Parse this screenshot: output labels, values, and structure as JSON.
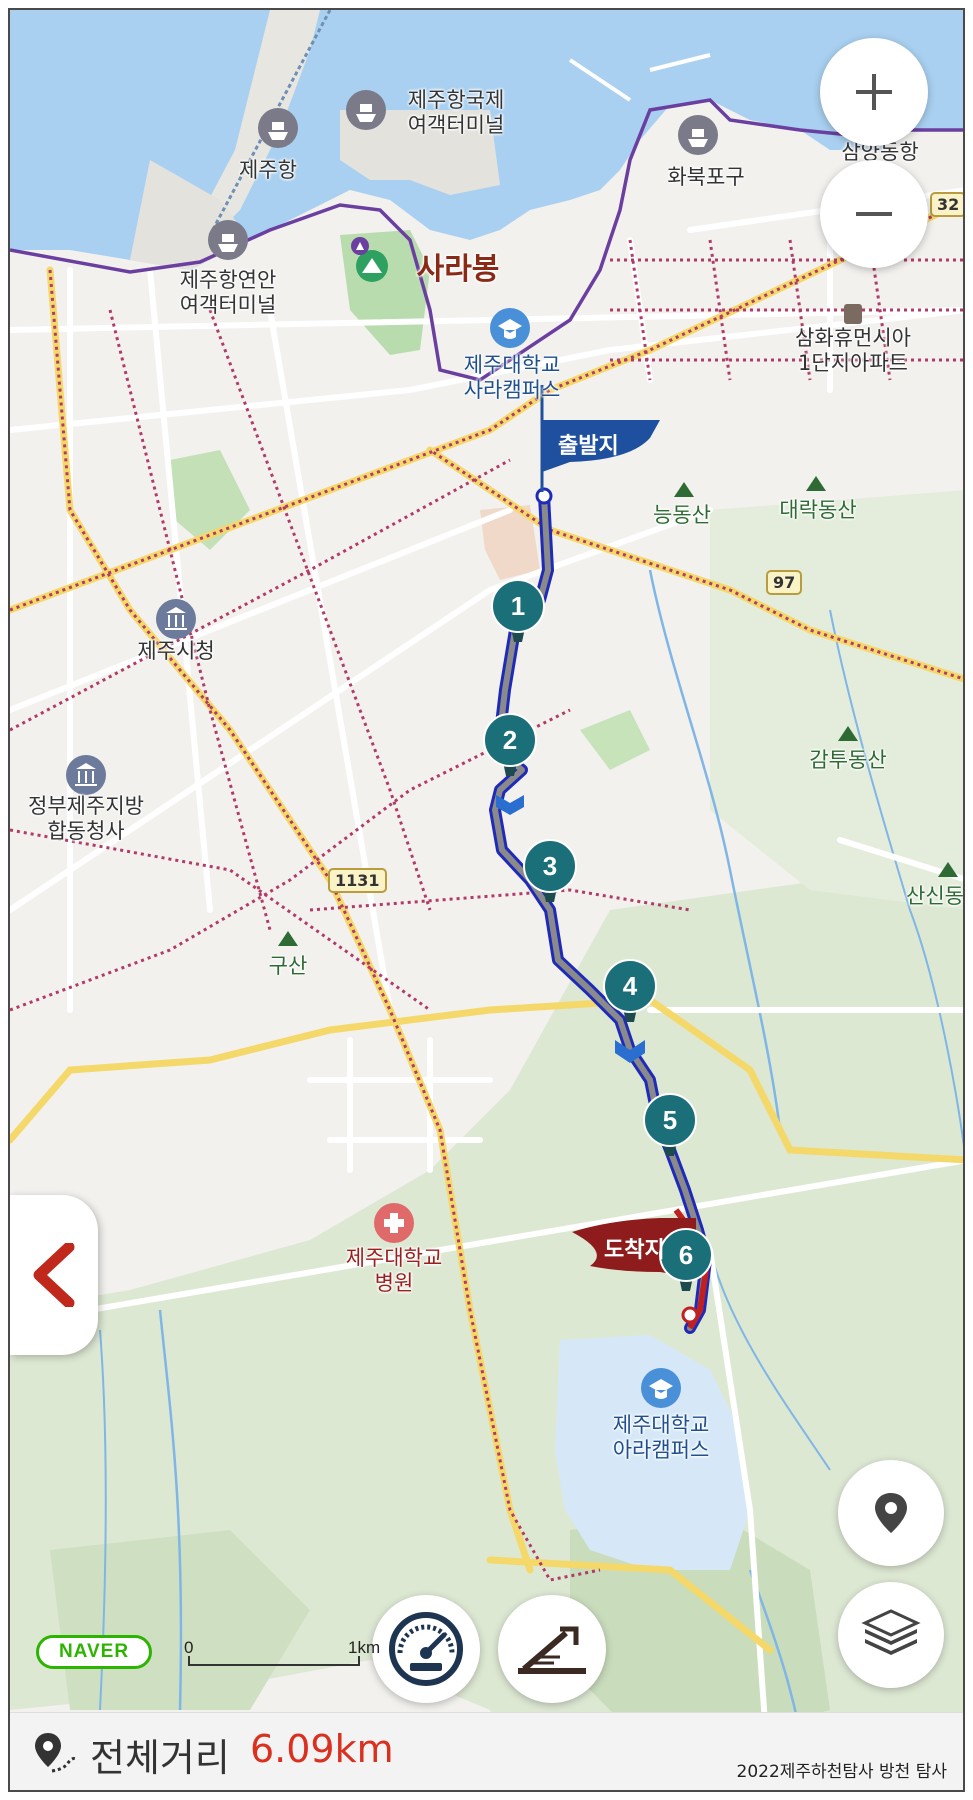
{
  "map": {
    "labels": {
      "jeju_port": "제주항",
      "jeju_port_intl": "제주항국제\n여객터미널",
      "hwabuk_port": "화북포구",
      "samyang": "삼양동항",
      "coastal_terminal": "제주항연안\n여객터미널",
      "sarabong": "사라봉",
      "jnu_sara": "제주대학교\n사라캠퍼스",
      "samhwa_apt": "삼화휴먼시아\n1단지아파트",
      "neungdongsan": "능동산",
      "daerakdongsan": "대락동산",
      "city_hall": "제주시청",
      "gov_complex": "정부제주지방\n합동청사",
      "gamtudongsan": "감투동산",
      "sansindong": "산신동",
      "gusan": "구산",
      "jnu_hospital": "제주대학교\n병원",
      "jnu_ara": "제주대학교\n아라캠퍼스"
    },
    "road_shields": {
      "r32": "32",
      "r97": "97",
      "r1131": "1131"
    },
    "start_flag": "출발지",
    "end_flag": "도착지",
    "markers": [
      "1",
      "2",
      "3",
      "4",
      "5",
      "6"
    ],
    "brand": "NAVER",
    "scale": {
      "zero": "0",
      "one": "1km"
    }
  },
  "controls": {
    "zoom_in_icon": "plus-icon",
    "zoom_out_icon": "minus-icon",
    "back_icon": "chevron-left-icon",
    "location_icon": "location-pin-icon",
    "layers_icon": "layers-icon",
    "speed_icon": "speedometer-icon",
    "elevation_icon": "elevation-icon"
  },
  "summary": {
    "distance_label": "전체거리",
    "distance_value": "6.09km",
    "credit": "2022제주하천탐사 방천 탐사"
  },
  "colors": {
    "route_blue": "#1f2bb8",
    "route_gray": "#8a8a8a",
    "marker_teal": "#1b6f78",
    "start_flag": "#1f4f9f",
    "end_flag": "#8e1c1c",
    "boundary_purple": "#6b3fa0",
    "distance_red": "#d9301f"
  }
}
